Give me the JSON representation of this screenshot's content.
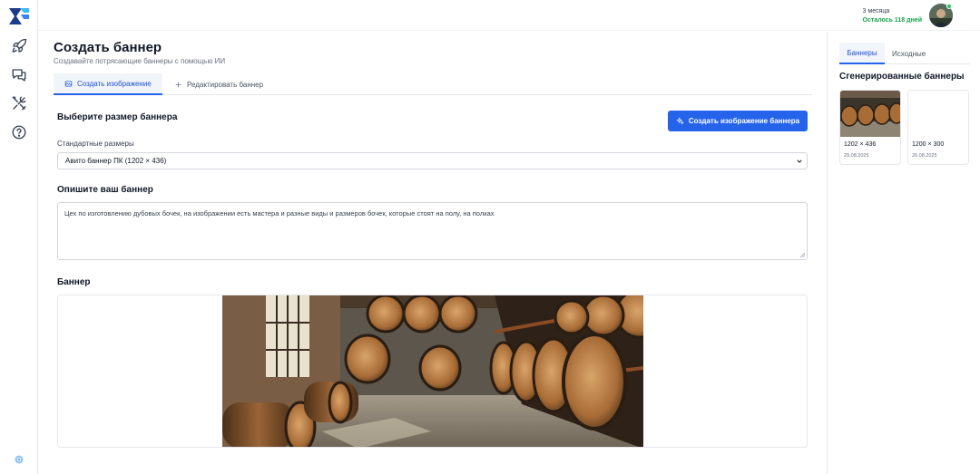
{
  "subscription": {
    "period": "3 месяца",
    "remaining": "Осталось 118 дней"
  },
  "rail": {
    "items": [
      {
        "icon": "rocket-icon"
      },
      {
        "icon": "chat-icon"
      },
      {
        "icon": "tools-icon"
      },
      {
        "icon": "help-icon"
      }
    ],
    "footer_icon": "settings-icon"
  },
  "page": {
    "title": "Создать баннер",
    "subtitle": "Создавайте потрясающие баннеры с помощью ИИ"
  },
  "tabs": [
    {
      "label": "Создать изображение",
      "active": true
    },
    {
      "label": "Редактировать баннер",
      "active": false
    }
  ],
  "size_section": {
    "heading": "Выберите размер баннера",
    "generate_button": "Создать изображение баннера",
    "field_label": "Стандартные размеры",
    "selected": "Авито баннер ПК (1202 × 436)"
  },
  "describe_section": {
    "heading": "Опишите ваш баннер",
    "text": "Цех по изготовлению дубовых бочек, на изображении есть мастера и разные виды и размеров бочек, которые стоят на полу, на полках"
  },
  "banner_section": {
    "heading": "Баннер"
  },
  "right_panel": {
    "tabs": [
      {
        "label": "Баннеры",
        "active": true
      },
      {
        "label": "Исходные",
        "active": false
      }
    ],
    "title": "Сгенерированные баннеры",
    "cards": [
      {
        "size": "1202 × 436",
        "date": "29.08.2025"
      },
      {
        "size": "1200 × 300",
        "date": "26.08.2025"
      }
    ]
  },
  "colors": {
    "accent": "#2563eb",
    "success": "#16a34a"
  }
}
